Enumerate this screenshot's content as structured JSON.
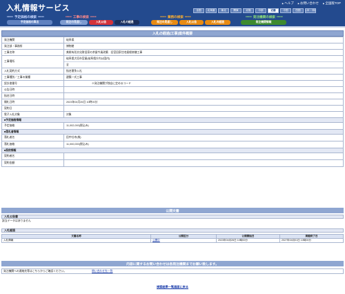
{
  "header": {
    "title": "入札情報サービス",
    "util_links": [
      "ヘルプ",
      "お問い合わせ",
      "全国版TOP"
    ],
    "regions": [
      "全国",
      "北海道",
      "東北",
      "関東",
      "北陸",
      "中部",
      "近畿",
      "中国",
      "四国",
      "九州・沖縄"
    ],
    "active_region": "近畿",
    "groups": {
      "search": "予定価格の検索",
      "works": "工事の検索",
      "consult": "業務の検索",
      "org": "発注機関の検索"
    },
    "pills": {
      "plan": "予定価格の算出",
      "notice": "発注の見通し",
      "announce": "入札公告",
      "result": "入札の経過",
      "c_notice": "発注の見通し",
      "c_announce": "入札公告",
      "c_result": "入札の経過",
      "org_info": "発注機関情報"
    }
  },
  "section_title": "入札の経過(工事)案件概要",
  "details": {
    "org": {
      "label": "発注機関",
      "value": "岐阜県"
    },
    "office": {
      "label": "発注部・事務所",
      "value": "博物館"
    },
    "name": {
      "label": "工事名称",
      "value": "美術有形文化財旧家の茶屋今風改築　旧宮田家住宅屋根修繕工事"
    },
    "place": {
      "label": "工事場所",
      "value1": "岐阜県大垣市宮屋(岐阜県庁内公園内)",
      "value2": "全"
    },
    "method": {
      "label": "入札契約方式",
      "value": "指名競争入札"
    },
    "category": {
      "label": "工事種別／工事の業種",
      "value": "建築一式工事"
    },
    "design_no": {
      "label": "設計書番号",
      "value": "※発注機関が独自に定めるコード"
    },
    "announce_date": {
      "label": "公告日時",
      "value": ""
    },
    "nominate_date": {
      "label": "指名日時",
      "value": ""
    },
    "open_date": {
      "label": "開札日時",
      "value": "2023年04月26日 10時00分"
    },
    "contract_date": {
      "label": "契約日",
      "value": ""
    },
    "e_bid": {
      "label": "電子入札対象",
      "value": "対象"
    },
    "g_price": "■予定価格情報",
    "planned_price": {
      "label": "予定価格",
      "value": "11,002,000(税込み)"
    },
    "g_winner": "■落札者情報",
    "winner": {
      "label": "落札者名",
      "value": "田中社寺(株)"
    },
    "win_price": {
      "label": "落札価格",
      "value": "11,000,000(税込み)"
    },
    "g_contract": "■契約情報",
    "contractor": {
      "label": "契約者名",
      "value": ""
    },
    "contract_amount": {
      "label": "契約金額",
      "value": ""
    }
  },
  "docs": {
    "banner": "公開文書",
    "announce_hd": "入札公告書",
    "no_data": "該当データはありません",
    "result_hd": "入札経過",
    "table_headers": [
      "文書名称",
      "公開区分",
      "公開開始日",
      "掲載終了日"
    ],
    "rows": [
      {
        "name": "入札情報",
        "kind": "公開中",
        "start": "2023年04月26日 10時00分",
        "end": "2027年04月01日 10時00分"
      }
    ]
  },
  "contact": {
    "banner": "内容に関するお問い合わせは各発注機関までお願い致します。",
    "text": "発注機関への連絡先等はこちらからご確認ください。",
    "link": "問い合わせ先一覧"
  },
  "back_link": "検索結果一覧画面に戻る"
}
